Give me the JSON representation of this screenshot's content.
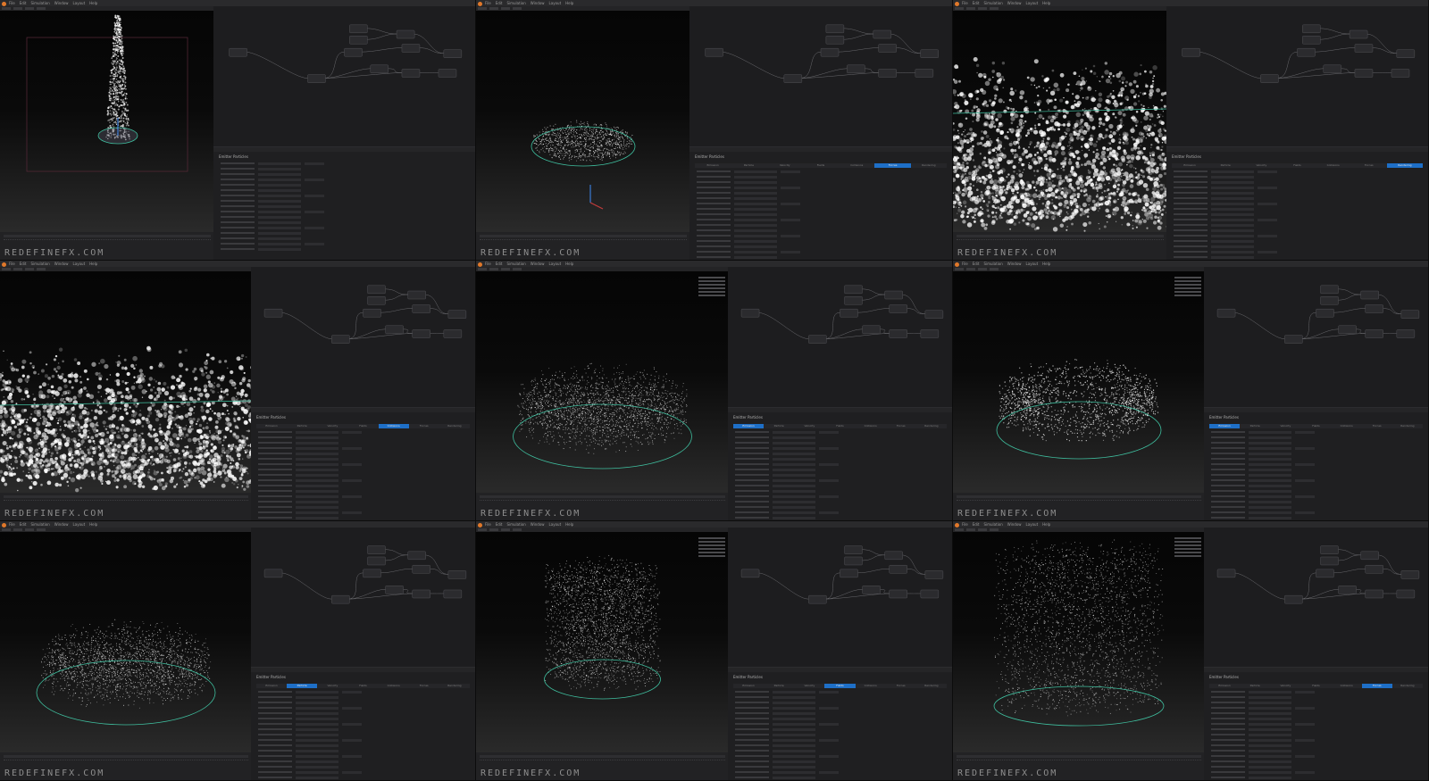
{
  "menu": {
    "items": [
      "File",
      "Edit",
      "Simulation",
      "Window",
      "Layout",
      "Help"
    ]
  },
  "watermark": "REDEFINEFX.COM",
  "panel": {
    "title": "Emitter Particles",
    "tabs": [
      "Emission",
      "Particle",
      "Velocity",
      "Fields",
      "Collisions",
      "Forces",
      "Rendering"
    ]
  },
  "colors": {
    "accent": "#1e6fc7",
    "collider": "#3fbf9f",
    "logo": "#e0782a"
  },
  "cells": [
    {
      "id": 1,
      "scene": "column",
      "active_tab": -1
    },
    {
      "id": 2,
      "scene": "ring-small",
      "active_tab": 5
    },
    {
      "id": 3,
      "scene": "closeup",
      "active_tab": 6
    },
    {
      "id": 4,
      "scene": "closeup-low",
      "active_tab": 4
    },
    {
      "id": 5,
      "scene": "disk",
      "active_tab": 0
    },
    {
      "id": 6,
      "scene": "ribbon-ring",
      "active_tab": 0
    },
    {
      "id": 7,
      "scene": "disk-low",
      "active_tab": 1
    },
    {
      "id": 8,
      "scene": "cylinder",
      "active_tab": 3
    },
    {
      "id": 9,
      "scene": "tall-cylinder",
      "active_tab": 5
    }
  ]
}
